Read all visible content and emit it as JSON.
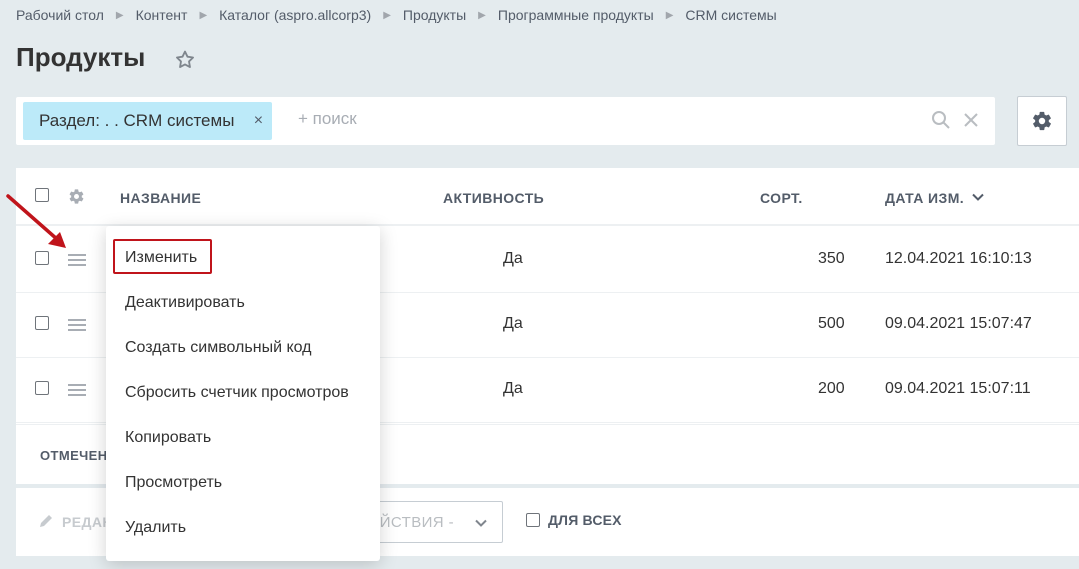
{
  "breadcrumb": [
    "Рабочий стол",
    "Контент",
    "Каталог (aspro.allcorp3)",
    "Продукты",
    "Программные продукты",
    "CRM системы"
  ],
  "page": {
    "title": "Продукты"
  },
  "filter": {
    "chip_label": "Раздел: . . CRM системы",
    "chip_close": "×",
    "search_placeholder": "+ поиск"
  },
  "grid": {
    "columns": {
      "name": "НАЗВАНИЕ",
      "active": "АКТИВНОСТЬ",
      "sort": "СОРТ.",
      "date": "ДАТА ИЗМ."
    },
    "sort_column": "date",
    "rows": [
      {
        "active": "Да",
        "sort": "350",
        "date": "12.04.2021 16:10:13"
      },
      {
        "active": "Да",
        "sort": "500",
        "date": "09.04.2021 15:07:47"
      },
      {
        "active": "Да",
        "sort": "200",
        "date": "09.04.2021 15:07:11"
      }
    ]
  },
  "marked_label": "ОТМЕЧЕН",
  "actions": {
    "edit_label": "РЕДАК",
    "select_value": "ЕЙСТВИЯ -",
    "for_all_label": "ДЛЯ ВСЕХ"
  },
  "context_menu": {
    "items": [
      "Изменить",
      "Деактивировать",
      "Создать символьный код",
      "Сбросить счетчик просмотров",
      "Копировать",
      "Просмотреть",
      "Удалить"
    ],
    "highlighted_item": "Изменить",
    "highlight_color": "#c0141b"
  },
  "colors": {
    "chip_bg": "#bceaf9",
    "page_bg": "#e4ebee",
    "arrow": "#c0141b"
  },
  "icons": [
    "star-icon",
    "search-icon",
    "clear-icon",
    "gear-icon",
    "chevron-down-icon",
    "pencil-icon",
    "menu-icon",
    "arrow-annotation"
  ]
}
